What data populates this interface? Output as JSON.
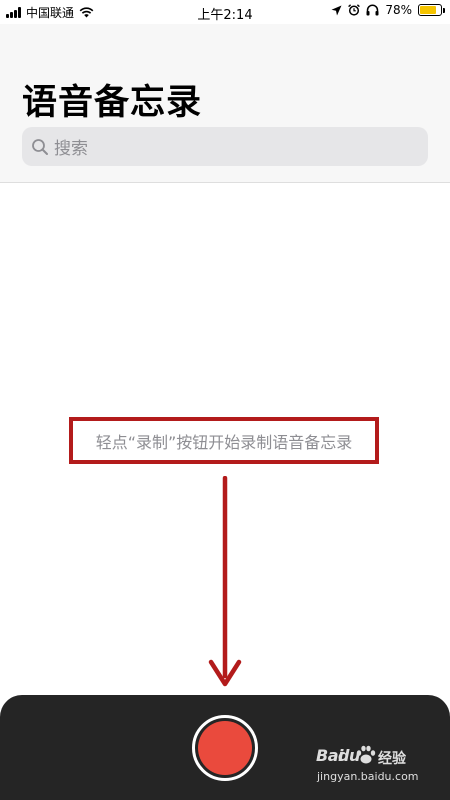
{
  "status_bar": {
    "carrier": "中国联通",
    "time": "上午2:14",
    "battery_percent": "78%",
    "battery_level": 0.78,
    "icons": [
      "signal-icon",
      "wifi-icon",
      "location-arrow-icon",
      "alarm-icon",
      "headphones-icon",
      "battery-icon"
    ]
  },
  "header": {
    "title": "语音备忘录"
  },
  "search": {
    "placeholder": "搜索"
  },
  "empty_state": {
    "hint": "轻点“录制”按钮开始录制语音备忘录"
  },
  "annotation": {
    "box_color": "#b31b1b",
    "arrow_color": "#b31b1b"
  },
  "record_panel": {
    "background": "#252525",
    "button_color": "#ea4a3d",
    "button_icon": "record-icon"
  },
  "watermark": {
    "logo": "Bai",
    "logo_suffix": "du",
    "brand": "经验",
    "url": "jingyan.baidu.com"
  }
}
